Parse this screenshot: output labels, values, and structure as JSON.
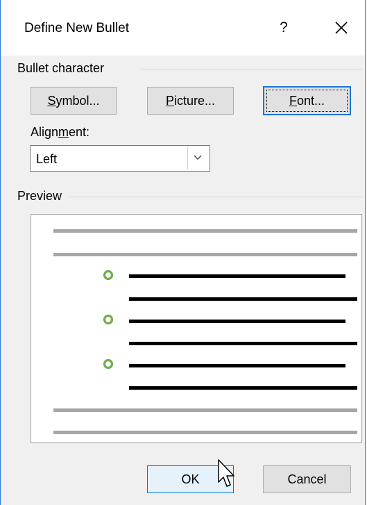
{
  "dialog": {
    "title": "Define New Bullet",
    "help_label": "?",
    "close_icon": "close-icon"
  },
  "bullet_character": {
    "group_label": "Bullet character",
    "symbol_label": {
      "pre": "",
      "key": "S",
      "post": "ymbol..."
    },
    "picture_label": {
      "pre": "",
      "key": "P",
      "post": "icture..."
    },
    "font_label": {
      "pre": "",
      "key": "F",
      "post": "ont..."
    }
  },
  "alignment": {
    "label": {
      "pre": "Align",
      "key": "m",
      "post": "ent:"
    },
    "selected": "Left",
    "arrow_icon": "chevron-down-icon"
  },
  "preview": {
    "group_label": "Preview",
    "bullet_color": "#70ad47",
    "bullet_count": 3
  },
  "footer": {
    "ok_label": "OK",
    "cancel_label": "Cancel"
  },
  "colors": {
    "window_border": "#2b79d7",
    "focus_accent": "#1e74d2"
  }
}
